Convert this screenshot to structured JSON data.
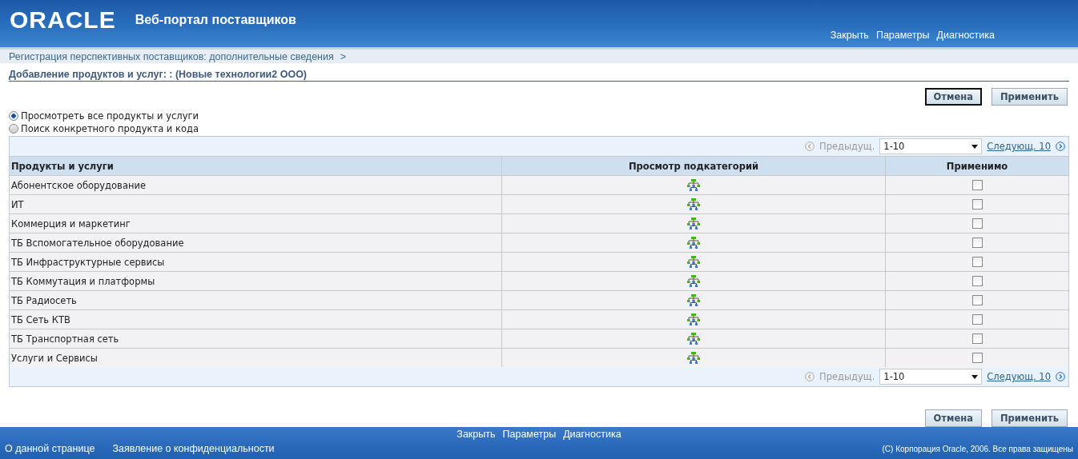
{
  "header": {
    "logo": "ORACLE",
    "title": "Веб-портал поставщиков",
    "links": [
      "Закрыть",
      "Параметры",
      "Диагностика"
    ]
  },
  "breadcrumb": {
    "text": "Регистрация перспективных поставщиков: дополнительные сведения",
    "separator": ">"
  },
  "page_title": "Добавление продуктов и услуг: : (Новые технологии2 ООО)",
  "buttons": [
    {
      "label": "Отмена",
      "selected": true
    },
    {
      "label": "Применить",
      "selected": false
    }
  ],
  "radios": [
    {
      "label": "Просмотреть все продукты и услуги",
      "selected": true
    },
    {
      "label": "Поиск конкретного продукта и кода",
      "selected": false
    }
  ],
  "pager": {
    "prev": "Предыдущ.",
    "range": "1-10",
    "next": "Следующ. 10"
  },
  "table": {
    "columns": [
      "Продукты и услуги",
      "Просмотр подкатегорий",
      "Применимо"
    ],
    "rows": [
      {
        "name": "Абонентское оборудование",
        "checked": false
      },
      {
        "name": "ИТ",
        "checked": false
      },
      {
        "name": "Коммерция и маркетинг",
        "checked": false
      },
      {
        "name": "ТБ Вспомогательное оборудование",
        "checked": false
      },
      {
        "name": "ТБ Инфраструктурные сервисы",
        "checked": false
      },
      {
        "name": "ТБ Коммутация и платформы",
        "checked": false
      },
      {
        "name": "ТБ Радиосеть",
        "checked": false
      },
      {
        "name": "ТБ Сеть КТВ",
        "checked": false
      },
      {
        "name": "ТБ Транспортная сеть",
        "checked": false
      },
      {
        "name": "Услуги и Сервисы",
        "checked": false
      }
    ]
  },
  "bottom_pager": {
    "prev": "Предыдущ.",
    "range": "1-10",
    "next": "Следующ. 10"
  },
  "bottom_buttons": [
    {
      "label": "Отмена",
      "selected": false
    },
    {
      "label": "Применить",
      "selected": false
    }
  ],
  "footer": {
    "links": [
      "Закрыть",
      "Параметры",
      "Диагностика"
    ],
    "left_links": [
      "О данной странице",
      "Заявление о конфиденциальности"
    ],
    "copyright": "(C) Корпорация Oracle, 2006. Все права защищены"
  }
}
